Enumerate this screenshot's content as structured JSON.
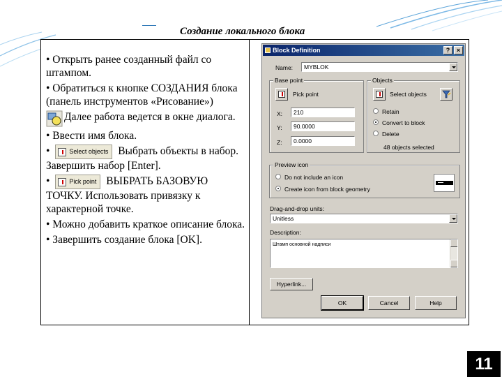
{
  "slide": {
    "title": "Создание локального блока",
    "page_number": "11"
  },
  "instructions": [
    "• Открыть ранее созданный файл со штампом.",
    "• Обратиться к кнопке СОЗДАНИЯ блока (панель инструментов «Рисование»)",
    "Далее работа ведется в окне диалога.",
    "• Ввести имя блока.",
    "Выбрать объекты в набор. Завершить набор [Enter].",
    "ВЫБРАТЬ БАЗОВУЮ ТОЧКУ. Использовать привязку к характерной точке.",
    "• Можно добавить краткое описание блока.",
    "• Завершить создание блока [OK]."
  ],
  "inline_buttons": {
    "select_objects": "Select objects",
    "pick_point": "Pick point"
  },
  "bullet": "•",
  "dialog": {
    "title": "Block Definition",
    "help_btn": "?",
    "close_btn": "×",
    "name_label": "Name:",
    "name_value": "MYBLOK",
    "base_point": {
      "label": "Base point",
      "pick_point": "Pick point",
      "x_label": "X:",
      "x_value": "210",
      "y_label": "Y:",
      "y_value": "90.0000",
      "z_label": "Z:",
      "z_value": "0.0000"
    },
    "objects": {
      "label": "Objects",
      "select_objects": "Select objects",
      "retain": "Retain",
      "convert": "Convert to block",
      "delete": "Delete",
      "selected_count": "48 objects selected"
    },
    "preview": {
      "label": "Preview icon",
      "no_icon": "Do not include an icon",
      "create_icon": "Create icon from block geometry"
    },
    "units": {
      "label": "Drag-and-drop units:",
      "value": "Unitless"
    },
    "description": {
      "label": "Description:",
      "value": "Штамп основной надписи"
    },
    "hyperlink": "Hyperlink...",
    "ok": "OK",
    "cancel": "Cancel",
    "help": "Help"
  },
  "colors": {
    "titlebar_start": "#0a246a",
    "titlebar_end": "#3a6ea5",
    "dialog_face": "#d4d0c8",
    "badge": "#000000"
  }
}
